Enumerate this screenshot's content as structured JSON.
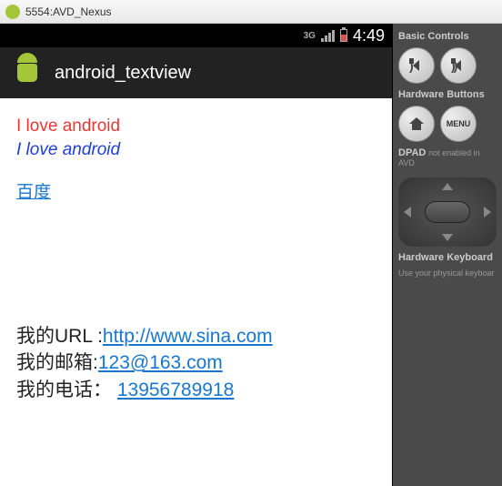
{
  "window": {
    "title": "5554:AVD_Nexus"
  },
  "statusbar": {
    "network": "3G",
    "time": "4:49"
  },
  "appbar": {
    "title": "android_textview"
  },
  "content": {
    "line1": "I love android",
    "line2": "I love android",
    "baidu_link": "百度",
    "url_label": "我的URL :",
    "url_value": "http://www.sina.com",
    "email_label": "我的邮箱:",
    "email_value": "123@163.com",
    "phone_label": "我的电话：",
    "phone_value": "13956789918"
  },
  "sidepanel": {
    "basic_controls": "Basic Controls",
    "hardware_buttons": "Hardware Buttons",
    "dpad_label": "DPAD",
    "dpad_note": "not enabled in AVD",
    "hw_keyboard": "Hardware Keyboard",
    "hw_keyboard_note": "Use your physical keyboar",
    "menu_label": "MENU"
  }
}
